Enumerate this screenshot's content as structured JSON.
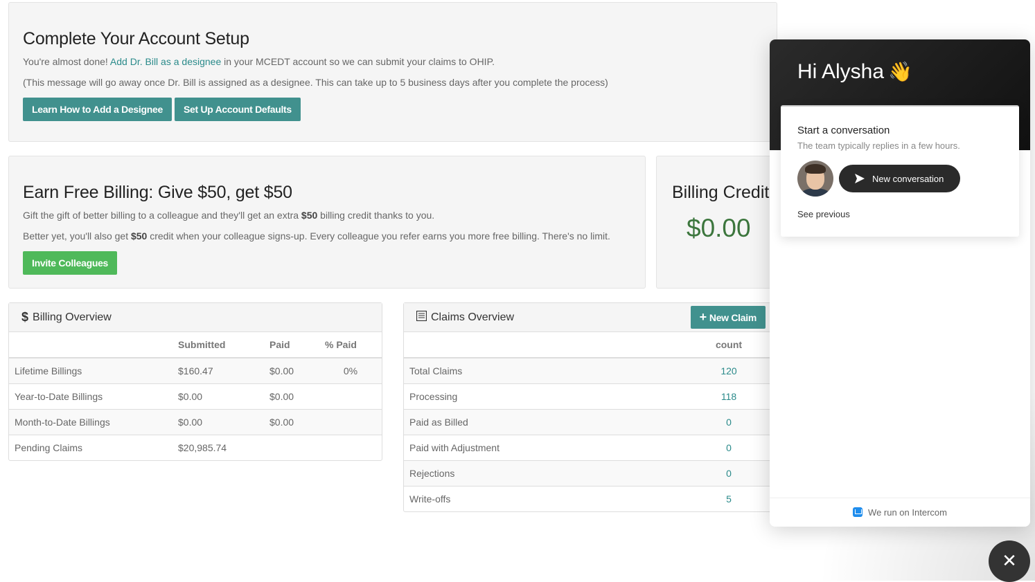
{
  "setup": {
    "title": "Complete Your Account Setup",
    "msg_prefix": "You're almost done! ",
    "msg_link": "Add Dr. Bill as a designee",
    "msg_suffix": " in your MCEDT account so we can submit your claims to OHIP.",
    "note": "(This message will go away once Dr. Bill is assigned as a designee. This can take up to 5 business days after you complete the process)",
    "btn_learn": "Learn How to Add a Designee",
    "btn_defaults": "Set Up Account Defaults"
  },
  "earn": {
    "title": "Earn Free Billing: Give $50, get $50",
    "line1_prefix": "Gift the gift of better billing to a colleague and they'll get an extra ",
    "line1_bold": "$50",
    "line1_suffix": " billing credit thanks to you.",
    "line2_prefix": "Better yet, you'll also get ",
    "line2_bold": "$50",
    "line2_suffix": " credit when your colleague signs-up. Every colleague you refer earns you more free billing. There's no limit.",
    "btn_invite": "Invite Colleagues"
  },
  "credit": {
    "title": "Billing Credit",
    "value": "$0.00"
  },
  "billing": {
    "icon": "$",
    "title": "Billing Overview",
    "columns": [
      "",
      "Submitted",
      "Paid",
      "% Paid"
    ],
    "rows": [
      [
        "Lifetime Billings",
        "$160.47",
        "$0.00",
        "0%"
      ],
      [
        "Year-to-Date Billings",
        "$0.00",
        "$0.00",
        ""
      ],
      [
        "Month-to-Date Billings",
        "$0.00",
        "$0.00",
        ""
      ],
      [
        "Pending Claims",
        "$20,985.74",
        "",
        ""
      ]
    ]
  },
  "claims": {
    "title": "Claims Overview",
    "new_claim": "New Claim",
    "columns": [
      "",
      "count"
    ],
    "rows": [
      [
        "Total Claims",
        "120"
      ],
      [
        "Processing",
        "118"
      ],
      [
        "Paid as Billed",
        "0"
      ],
      [
        "Paid with Adjustment",
        "0"
      ],
      [
        "Rejections",
        "0"
      ],
      [
        "Write-offs",
        "5"
      ]
    ]
  },
  "intercom": {
    "greeting": "Hi Alysha",
    "wave": "👋",
    "card_title": "Start a conversation",
    "card_sub": "The team typically replies in a few hours.",
    "new_conversation": "New conversation",
    "see_previous": "See previous",
    "footer": "We run on Intercom",
    "close": "✕"
  }
}
